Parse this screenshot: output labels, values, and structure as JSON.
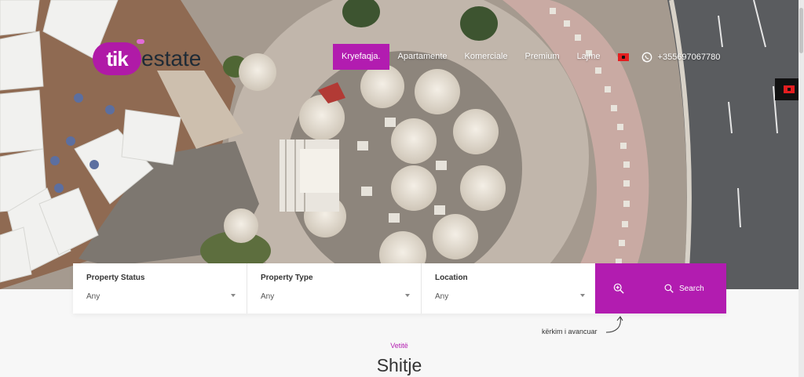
{
  "brand": {
    "logo_pill": "tik",
    "logo_word": "estate"
  },
  "nav": {
    "items": [
      {
        "label": "Kryefaqja.",
        "active": true
      },
      {
        "label": "Apartamente",
        "active": false
      },
      {
        "label": "Komerciale",
        "active": false
      },
      {
        "label": "Premium",
        "active": false
      },
      {
        "label": "Lajme",
        "active": false
      }
    ],
    "language_flag": "albanian-flag-icon",
    "phone": "+355697067780",
    "phone_icon": "whatsapp-icon"
  },
  "side_language": {
    "icon": "albanian-flag-icon"
  },
  "search": {
    "fields": [
      {
        "label": "Property Status",
        "value": "Any"
      },
      {
        "label": "Property Type",
        "value": "Any"
      },
      {
        "label": "Location",
        "value": "Any"
      }
    ],
    "advanced_icon": "zoom-in-icon",
    "search_label": "Search",
    "search_icon": "search-icon",
    "advanced_hint": "kërkim i avancuar"
  },
  "section": {
    "kicker": "Vetitë",
    "title": "Shitje"
  },
  "colors": {
    "accent": "#b21cb0",
    "dark": "#1f2b36"
  }
}
